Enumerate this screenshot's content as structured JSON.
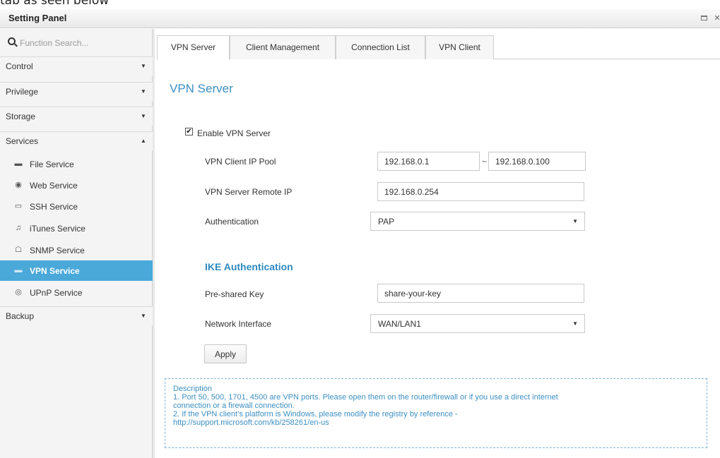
{
  "caption": "tab as seen below",
  "window": {
    "title": "Setting Panel"
  },
  "sidebar": {
    "search_placeholder": "Function Search...",
    "groups": {
      "control": "Control",
      "privilege": "Privilege",
      "storage": "Storage",
      "services": "Services",
      "backup": "Backup"
    },
    "service_items": [
      {
        "label": "File Service",
        "icon": "file-service-icon"
      },
      {
        "label": "Web Service",
        "icon": "web-service-icon"
      },
      {
        "label": "SSH Service",
        "icon": "ssh-terminal-icon"
      },
      {
        "label": "iTunes Service",
        "icon": "music-note-icon"
      },
      {
        "label": "SNMP Service",
        "icon": "network-tree-icon"
      },
      {
        "label": "VPN Service",
        "icon": "vpn-icon",
        "active": true
      },
      {
        "label": "UPnP Service",
        "icon": "broadcast-icon"
      }
    ]
  },
  "tabs": [
    "VPN Server",
    "Client Management",
    "Connection List",
    "VPN Client"
  ],
  "content": {
    "title": "VPN Server",
    "enable_label": "Enable VPN Server",
    "enable_checked": true,
    "ip_pool_label": "VPN Client IP Pool",
    "ip_pool_start": "192.168.0.1",
    "ip_pool_separator": "~",
    "ip_pool_end": "192.168.0.100",
    "remote_ip_label": "VPN Server Remote IP",
    "remote_ip": "192.168.0.254",
    "auth_label": "Authentication",
    "auth_value": "PAP",
    "ike_title": "IKE Authentication",
    "psk_label": "Pre-shared Key",
    "psk_value": "share-your-key",
    "iface_label": "Network Interface",
    "iface_value": "WAN/LAN1",
    "apply_label": "Apply"
  },
  "description": {
    "title": "Description",
    "line1": "1. Port 50, 500, 1701, 4500 are VPN ports. Please open them on the router/firewall or if you use a direct internet",
    "line1b": "connection or a firewall connection.",
    "line2": "2. If the VPN client’s platform is Windows, please modify the registry by reference -",
    "line2b": "http://support.microsoft.com/kb/258261/en-us"
  },
  "colors": {
    "accent": "#4aa9d9",
    "heading": "#3b8fc2",
    "description_text": "#3d8fc2"
  }
}
